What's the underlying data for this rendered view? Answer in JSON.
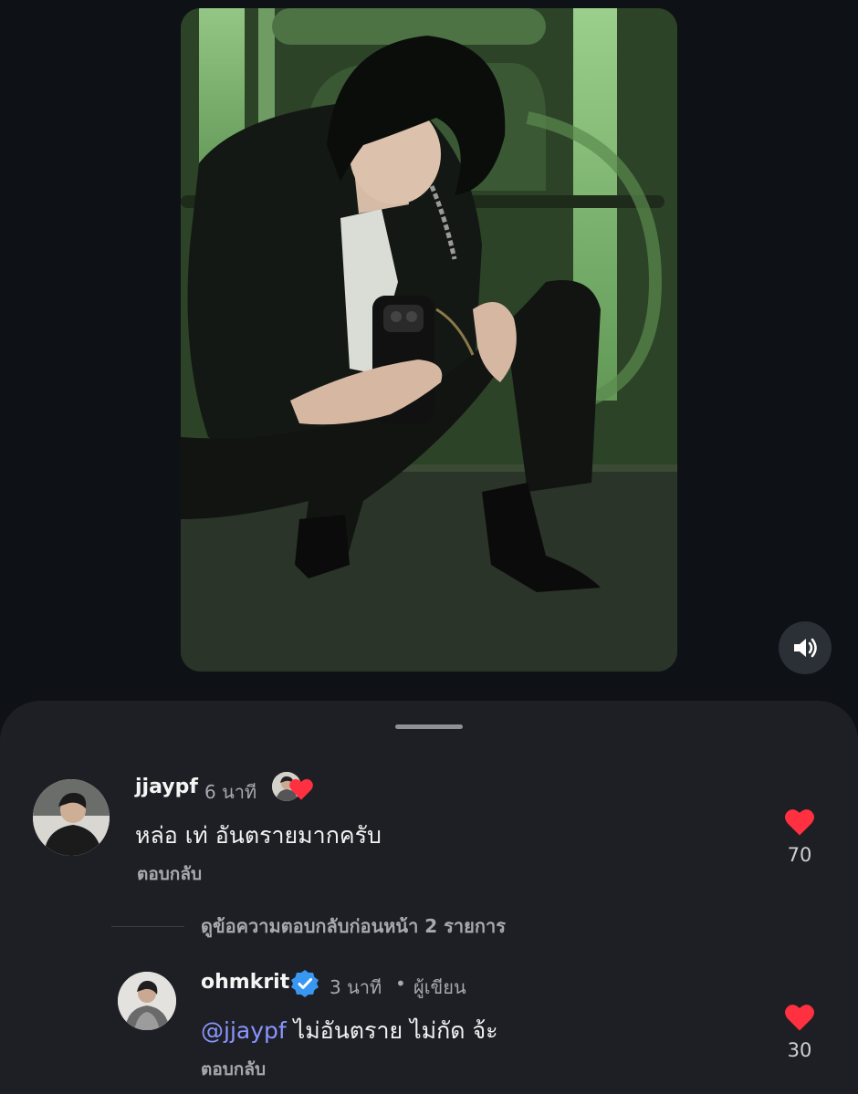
{
  "post": {
    "photo_alt_icon": "photo",
    "mute_icon": "speaker-icon"
  },
  "comments": [
    {
      "username": "jjaypf",
      "time": "6 นาที",
      "text": "หล่อ เท่ อันตรายมากครับ",
      "reply_label": "ตอบกลับ",
      "likes": "70",
      "liked_by_author": true
    }
  ],
  "view_previous_replies": "ดูข้อความตอบกลับก่อนหน้า 2 รายการ",
  "reply": {
    "username": "ohmkrit",
    "verified": true,
    "time": "3 นาที",
    "separator": "•",
    "author_tag": "ผู้เขียน",
    "mention": "@jjaypf",
    "text": " ไม่อันตราย ไม่กัด จ้ะ",
    "reply_label": "ตอบกลับ",
    "likes": "30"
  },
  "colors": {
    "background": "#0e1217",
    "sheet": "#1e1f24",
    "heart": "#ff3040",
    "mention": "#8a95ff",
    "verified": "#3897f0"
  }
}
